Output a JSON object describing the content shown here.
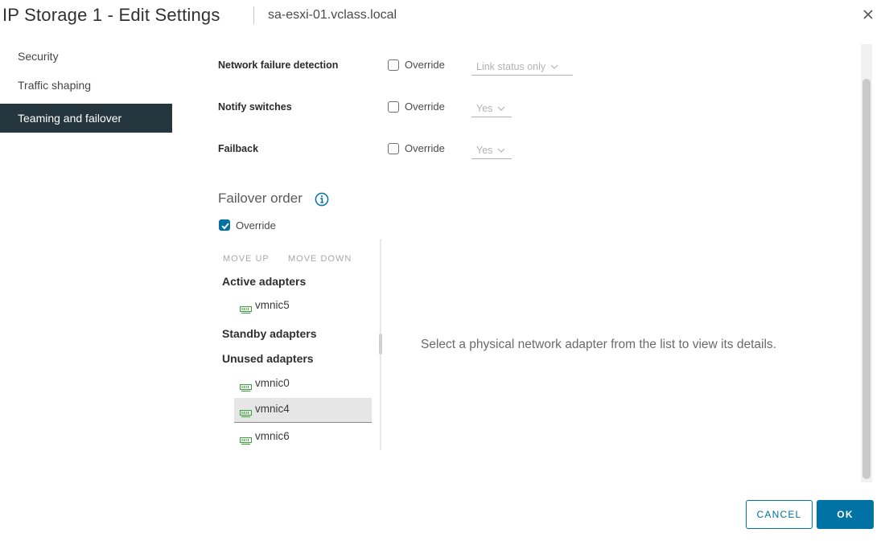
{
  "header": {
    "title": "IP Storage 1 - Edit Settings",
    "subtitle": "sa-esxi-01.vclass.local"
  },
  "nav": {
    "items": [
      {
        "label": "Security"
      },
      {
        "label": "Traffic shaping"
      },
      {
        "label": "Teaming and failover",
        "active": true
      }
    ]
  },
  "settings": {
    "network_failure_detection": {
      "label": "Network failure detection",
      "override_label": "Override",
      "override_checked": false,
      "value": "Link status only"
    },
    "notify_switches": {
      "label": "Notify switches",
      "override_label": "Override",
      "override_checked": false,
      "value": "Yes"
    },
    "failback": {
      "label": "Failback",
      "override_label": "Override",
      "override_checked": false,
      "value": "Yes"
    }
  },
  "failover_order": {
    "title": "Failover order",
    "override_label": "Override",
    "override_checked": true,
    "toolbar": {
      "move_up": "MOVE UP",
      "move_down": "MOVE DOWN"
    },
    "active_label": "Active adapters",
    "active": [
      "vmnic5"
    ],
    "standby_label": "Standby adapters",
    "standby": [],
    "unused_label": "Unused adapters",
    "unused": [
      "vmnic0",
      "vmnic4",
      "vmnic6"
    ],
    "selected": "vmnic4",
    "detail_message": "Select a physical network adapter from the list to view its details."
  },
  "footer": {
    "cancel_label": "CANCEL",
    "ok_label": "OK"
  },
  "colors": {
    "accent": "#0072a3",
    "nav_active_bg": "#26363f",
    "nic_icon": "#3aa33a"
  }
}
